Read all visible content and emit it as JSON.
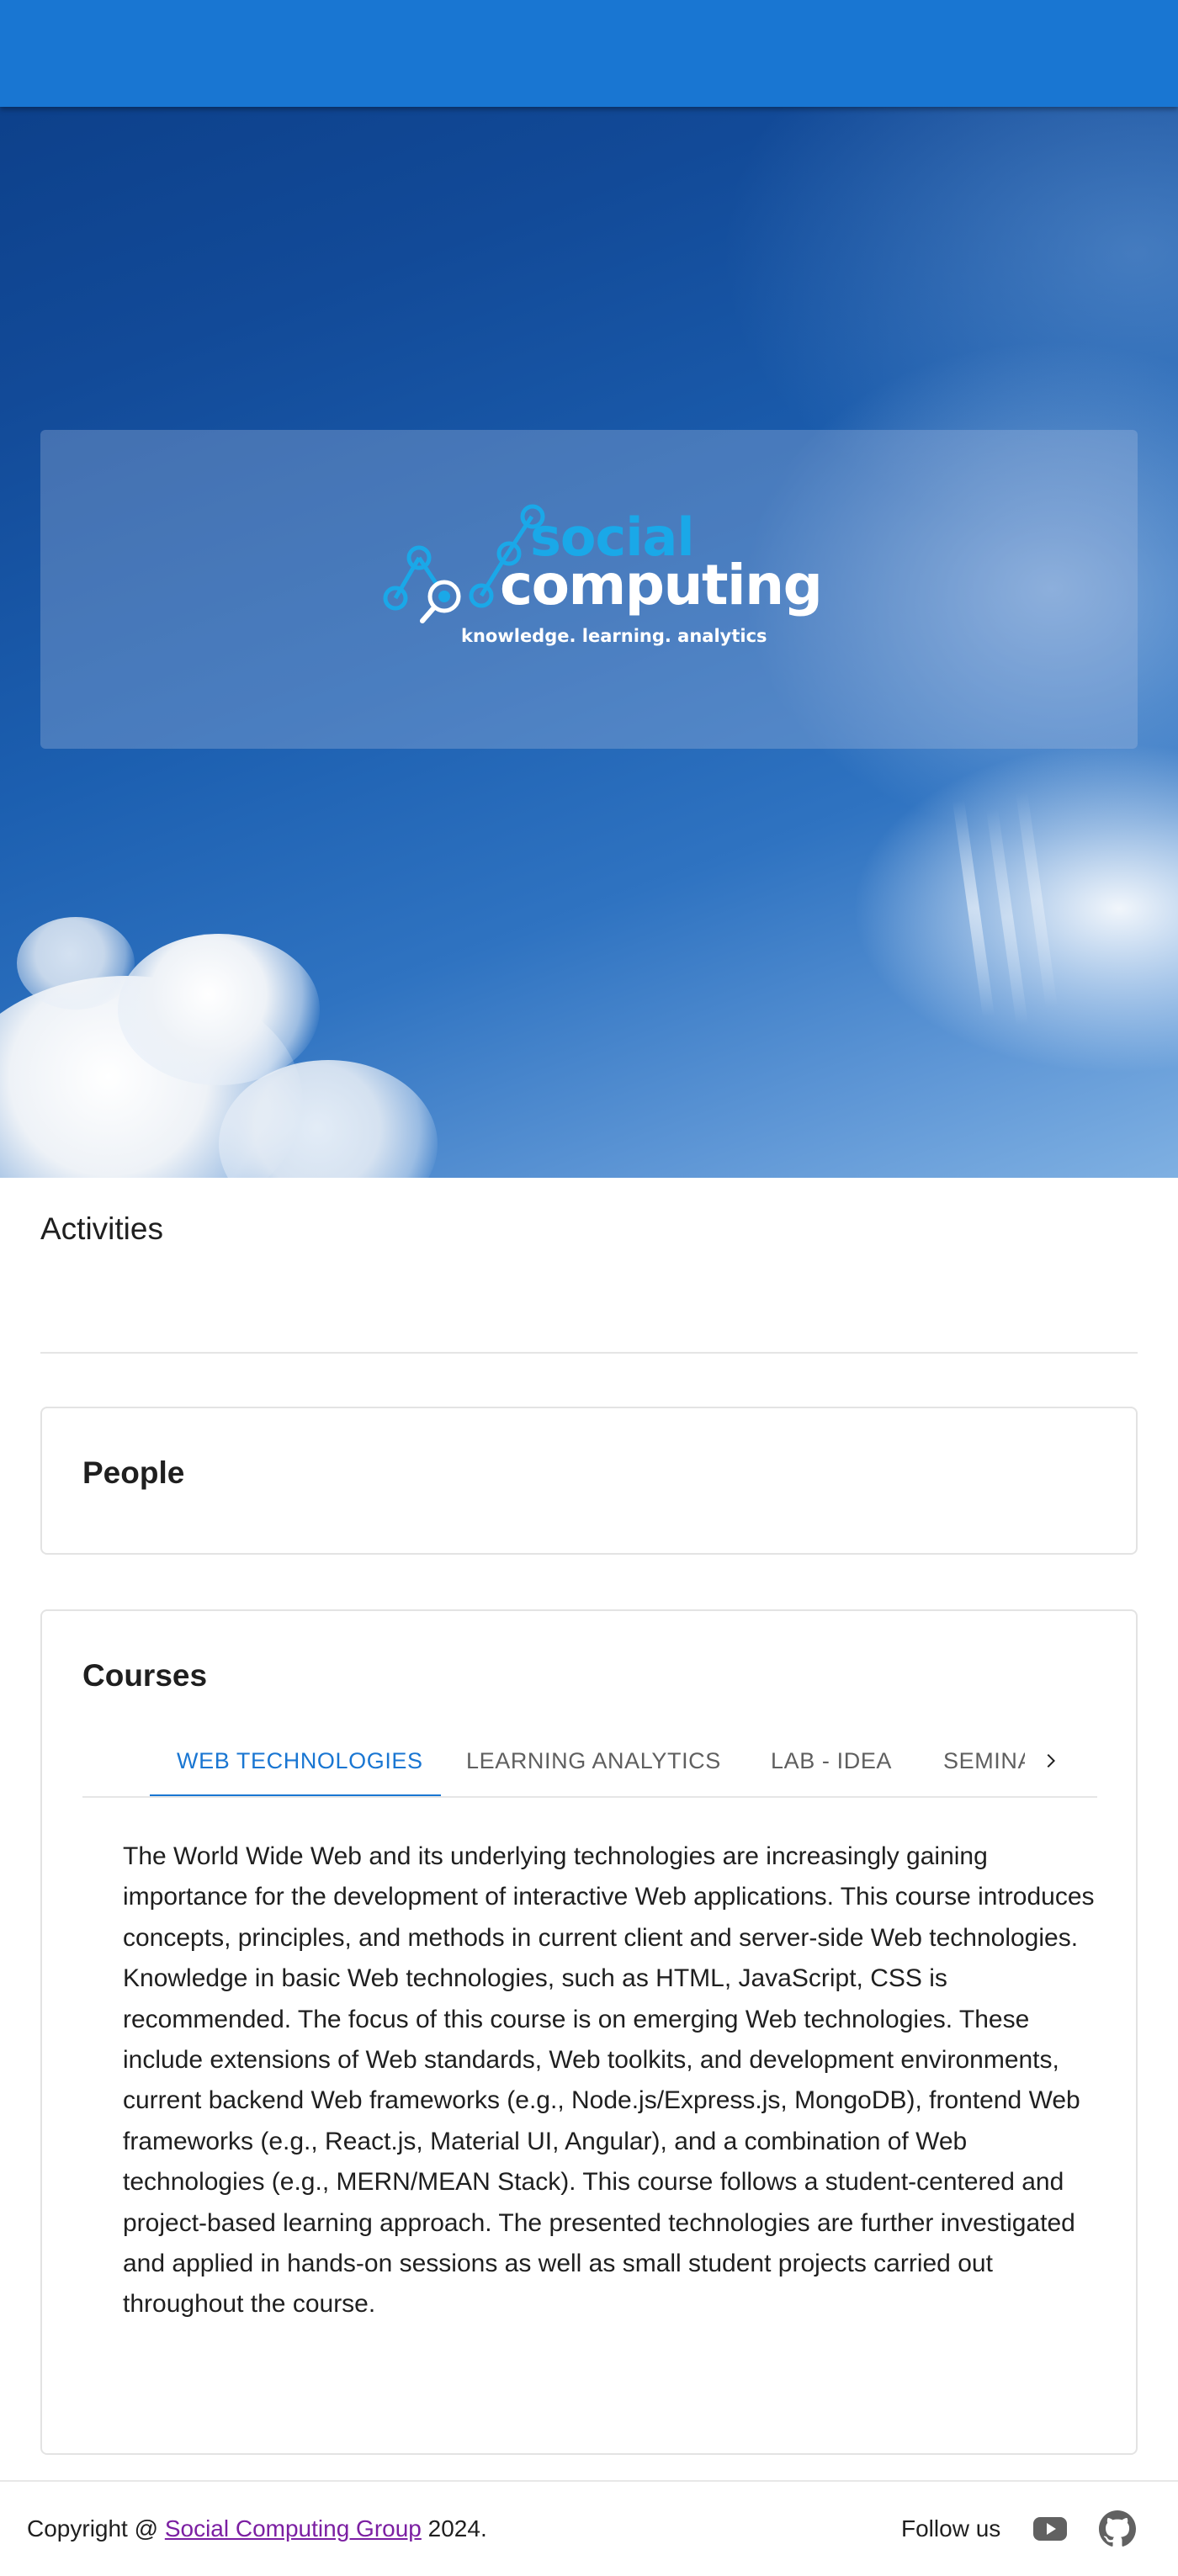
{
  "hero": {
    "logo": {
      "word_social": "social",
      "word_computing": "computing",
      "tagline": "knowledge. learning. analytics"
    }
  },
  "activities": {
    "title": "Activities"
  },
  "people": {
    "title": "People"
  },
  "courses": {
    "title": "Courses",
    "tabs": [
      {
        "label": "Web Technologies",
        "active": true
      },
      {
        "label": "Learning Analytics",
        "active": false
      },
      {
        "label": "Lab - IDEA",
        "active": false
      },
      {
        "label": "Semina",
        "active": false
      }
    ],
    "scroll_icon": "chevron-right-icon",
    "active_description": "The World Wide Web and its underlying technologies are increasingly gaining importance for the development of interactive Web applications. This course introduces concepts, principles, and methods in current client and server-side Web technologies. Knowledge in basic Web technologies, such as HTML, JavaScript, CSS is recommended. The focus of this course is on emerging Web technologies. These include extensions of Web standards, Web toolkits, and development environments, current backend Web frameworks (e.g., Node.js/Express.js, MongoDB), frontend Web frameworks (e.g., React.js, Material UI, Angular), and a combination of Web technologies (e.g., MERN/MEAN Stack). This course follows a student-centered and project-based learning approach. The presented technologies are further investigated and applied in hands-on sessions as well as small student projects carried out throughout the course."
  },
  "footer": {
    "copyright_prefix": "Copyright @ ",
    "group_link": "Social Computing Group",
    "copyright_suffix": " 2024.",
    "follow_label": "Follow us",
    "icons": [
      "youtube-icon",
      "github-icon"
    ]
  },
  "colors": {
    "primary": "#1976d2",
    "logo_blue": "#1aa8e8",
    "link_visited": "#7b1fa2"
  }
}
